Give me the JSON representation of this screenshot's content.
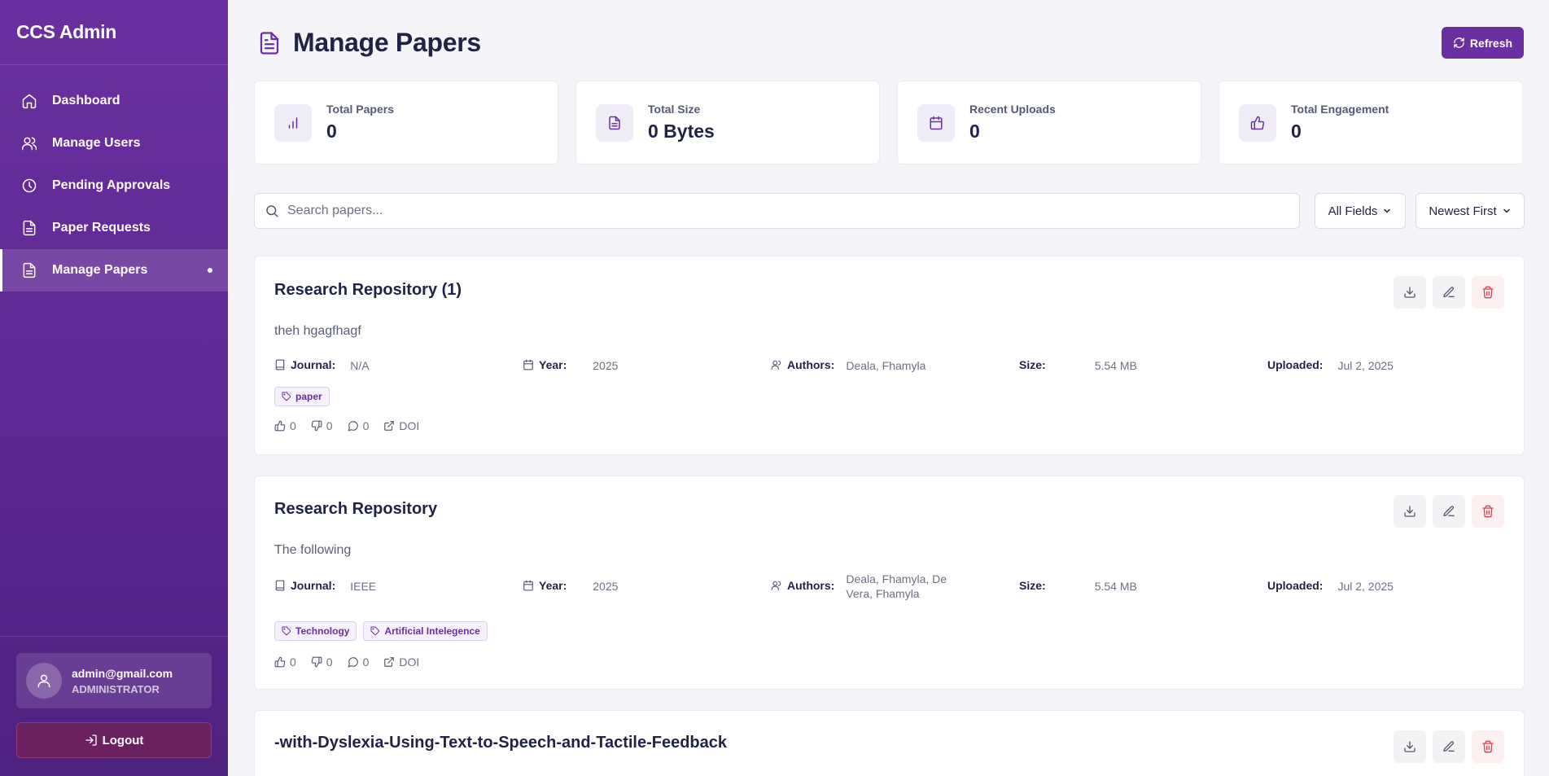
{
  "app": {
    "brand": "CCS Admin"
  },
  "sidebar": {
    "items": [
      {
        "label": "Dashboard",
        "icon": "home-icon"
      },
      {
        "label": "Manage Users",
        "icon": "users-icon"
      },
      {
        "label": "Pending Approvals",
        "icon": "clock-icon"
      },
      {
        "label": "Paper Requests",
        "icon": "file-icon"
      },
      {
        "label": "Manage Papers",
        "icon": "file-icon",
        "active": true
      }
    ],
    "user": {
      "email": "admin@gmail.com",
      "role": "ADMINISTRATOR"
    },
    "logout_label": "Logout"
  },
  "page": {
    "title": "Manage Papers",
    "refresh_label": "Refresh"
  },
  "stats": [
    {
      "label": "Total Papers",
      "value": "0",
      "icon": "bar-chart-icon"
    },
    {
      "label": "Total Size",
      "value": "0 Bytes",
      "icon": "file-text-icon"
    },
    {
      "label": "Recent Uploads",
      "value": "0",
      "icon": "calendar-icon"
    },
    {
      "label": "Total Engagement",
      "value": "0",
      "icon": "thumbs-up-icon"
    }
  ],
  "filters": {
    "search_placeholder": "Search papers...",
    "field_select": "All Fields",
    "sort_select": "Newest First"
  },
  "labels": {
    "journal": "Journal:",
    "year": "Year:",
    "authors": "Authors:",
    "size": "Size:",
    "uploaded": "Uploaded:",
    "doi": "DOI"
  },
  "papers": [
    {
      "title": "Research Repository (1)",
      "description": "theh hgagfhagf",
      "journal": "N/A",
      "year": "2025",
      "authors": "Deala, Fhamyla",
      "size": "5.54 MB",
      "uploaded": "Jul 2, 2025",
      "tags": [
        "paper"
      ],
      "likes": "0",
      "dislikes": "0",
      "comments": "0"
    },
    {
      "title": "Research Repository",
      "description": "The following",
      "journal": "IEEE",
      "year": "2025",
      "authors": "Deala, Fhamyla, De Vera, Fhamyla",
      "size": "5.54 MB",
      "uploaded": "Jul 2, 2025",
      "tags": [
        "Technology",
        "Artificial Intelegence"
      ],
      "likes": "0",
      "dislikes": "0",
      "comments": "0"
    },
    {
      "title": "-with-Dyslexia-Using-Text-to-Speech-and-Tactile-Feedback"
    }
  ],
  "colors": {
    "accent": "#6a2fa0",
    "danger": "#e0404a",
    "text": "#1f2346"
  }
}
